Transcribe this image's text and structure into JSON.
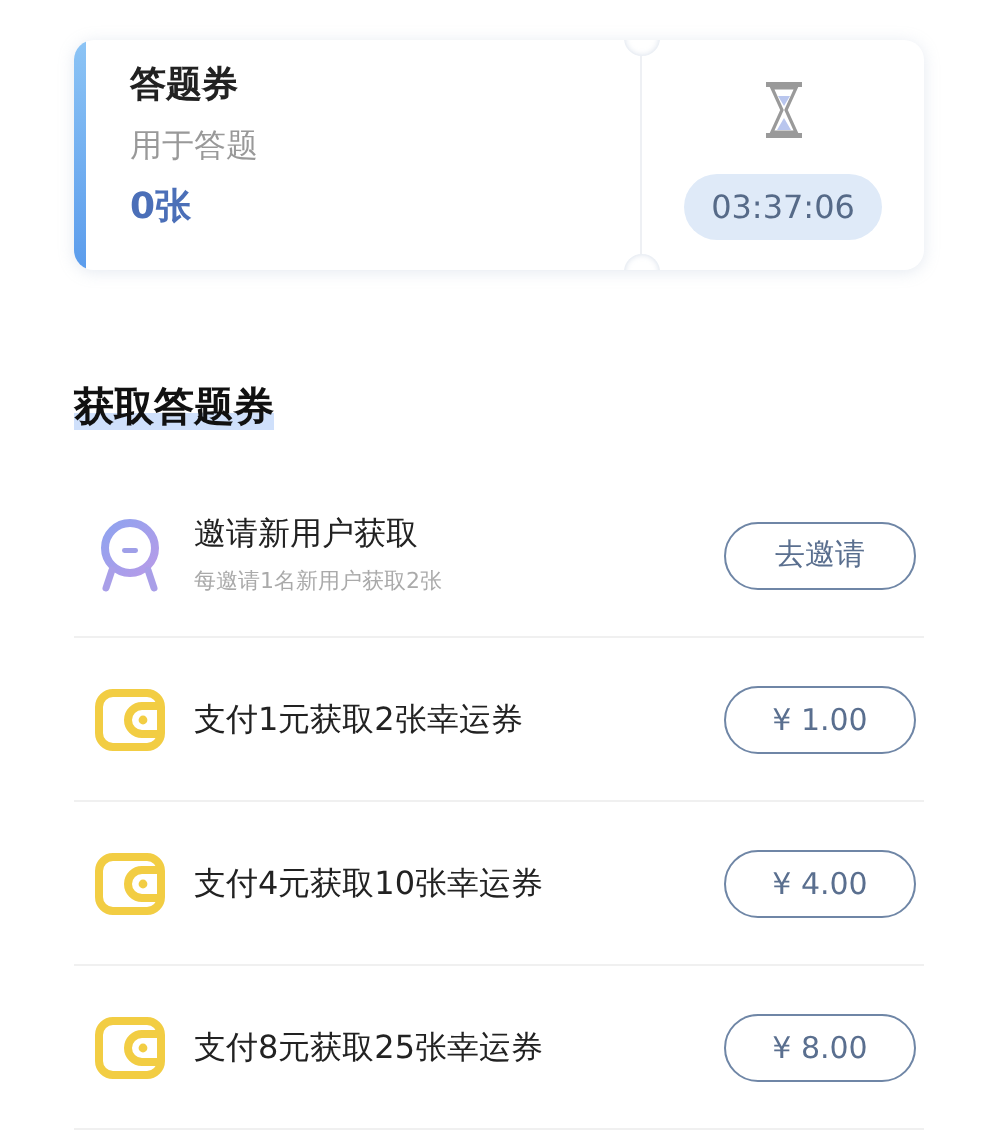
{
  "ticket_card": {
    "title": "答题券",
    "subtitle": "用于答题",
    "count": "0张",
    "timer": "03:37:06"
  },
  "section": {
    "title": "获取答题券"
  },
  "options": [
    {
      "kind": "invite",
      "title": "邀请新用户获取",
      "subtitle": "每邀请1名新用户获取2张",
      "button": "去邀请"
    },
    {
      "kind": "pay",
      "title": "支付1元获取2张幸运券",
      "button": "¥ 1.00"
    },
    {
      "kind": "pay",
      "title": "支付4元获取10张幸运券",
      "button": "¥ 4.00"
    },
    {
      "kind": "pay",
      "title": "支付8元获取25张幸运券",
      "button": "¥ 8.00"
    }
  ]
}
